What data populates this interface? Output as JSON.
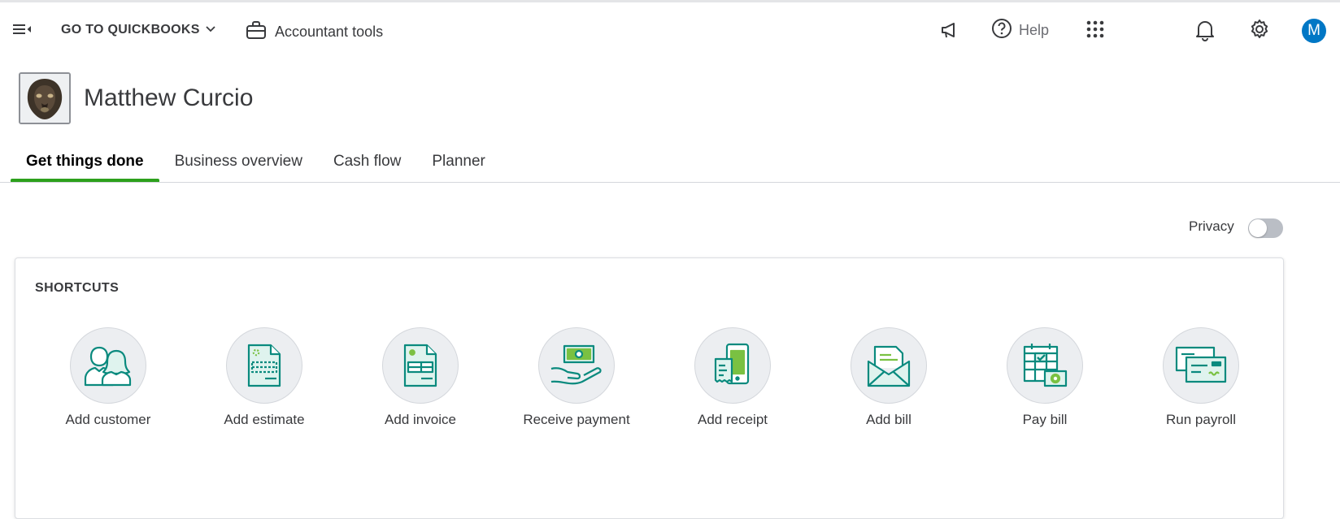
{
  "topbar": {
    "goto_label": "GO TO QUICKBOOKS",
    "accountant_tools_label": "Accountant tools",
    "help_label": "Help",
    "avatar_initial": "M",
    "icons": [
      "menu-collapse-icon",
      "chevron-down-icon",
      "briefcase-icon",
      "megaphone-icon",
      "help-icon",
      "apps-grid-icon",
      "search-icon",
      "bell-icon",
      "gear-icon"
    ]
  },
  "company": {
    "name": "Matthew Curcio"
  },
  "tabs": [
    {
      "label": "Get things done",
      "active": true
    },
    {
      "label": "Business overview",
      "active": false
    },
    {
      "label": "Cash flow",
      "active": false
    },
    {
      "label": "Planner",
      "active": false
    }
  ],
  "privacy": {
    "label": "Privacy",
    "enabled": false
  },
  "shortcuts": {
    "title": "SHORTCUTS",
    "items": [
      {
        "label": "Add customer",
        "icon": "customer-icon"
      },
      {
        "label": "Add estimate",
        "icon": "estimate-icon"
      },
      {
        "label": "Add invoice",
        "icon": "invoice-icon"
      },
      {
        "label": "Receive payment",
        "icon": "payment-icon"
      },
      {
        "label": "Add receipt",
        "icon": "receipt-icon"
      },
      {
        "label": "Add bill",
        "icon": "bill-icon"
      },
      {
        "label": "Pay bill",
        "icon": "pay-bill-icon"
      },
      {
        "label": "Run payroll",
        "icon": "payroll-icon"
      }
    ]
  },
  "colors": {
    "accent_green": "#2ca01c",
    "icon_teal": "#0a8a7e",
    "icon_light": "#dff3ee",
    "avatar_blue": "#0077c5"
  }
}
